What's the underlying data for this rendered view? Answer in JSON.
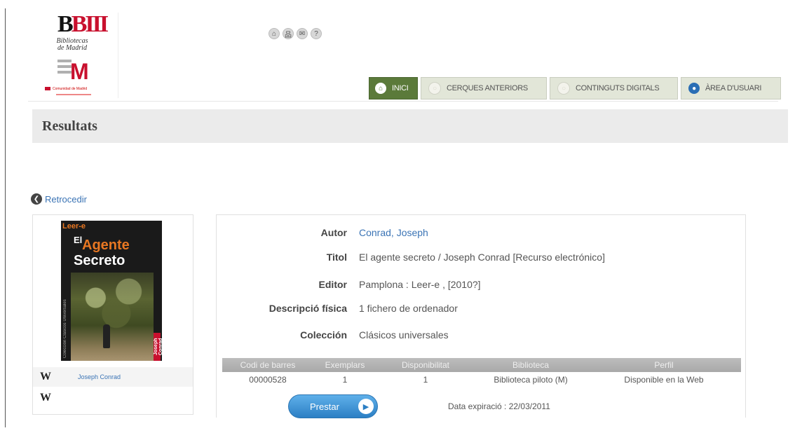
{
  "header": {
    "logo_bm_text": "BIII",
    "logo_subtitle": "Bibliotecas de Madrid",
    "logo_m_text": "M",
    "logo_comunidad": "Comunidad de Madrid",
    "top_icons": [
      {
        "icon": "home-icon",
        "glyph": "⌂"
      },
      {
        "icon": "sitemap-icon",
        "glyph": "品"
      },
      {
        "icon": "mail-icon",
        "glyph": "✉"
      },
      {
        "icon": "help-icon",
        "glyph": "?"
      }
    ]
  },
  "tabs": [
    {
      "label": "INICI",
      "icon": "home-icon",
      "glyph": "⌂"
    },
    {
      "label": "CERQUES ANTERIORS",
      "icon": "history-icon",
      "glyph": "○"
    },
    {
      "label": "CONTINGUTS DIGITALS",
      "icon": "digital-content-icon",
      "glyph": "○"
    },
    {
      "label": "ÀREA D'USUARI",
      "icon": "user-icon",
      "glyph": "●"
    }
  ],
  "page_title": "Resultats",
  "back_link": "Retrocedir",
  "cover": {
    "brand": "Leer-e",
    "title_small": "El",
    "title_line1": "Agente",
    "title_line2": "Secreto",
    "spine": "Colección Clásicos Universales",
    "author_spine": "Joseph Conrad"
  },
  "side_links": [
    {
      "icon": "wikipedia-icon",
      "glyph": "W",
      "label": "Joseph Conrad"
    },
    {
      "icon": "wikipedia-icon",
      "glyph": "W",
      "label": ""
    }
  ],
  "record": {
    "fields": [
      {
        "label": "Autor",
        "value": "Conrad, Joseph",
        "link": true
      },
      {
        "label": "Titol",
        "value": "El agente secreto / Joseph Conrad [Recurso electrónico]",
        "link": false
      },
      {
        "label": "Editor",
        "value": "Pamplona : Leer-e , [2010?]",
        "link": false
      },
      {
        "label": "Descripció física",
        "value": "1 fichero de ordenador",
        "link": false
      },
      {
        "label": "Colección",
        "value": "Clásicos universales",
        "link": false
      }
    ]
  },
  "copies_table": {
    "headers": [
      "Codi de barres",
      "Exemplars",
      "Disponibilitat",
      "Biblioteca",
      "Perfil"
    ],
    "rows": [
      [
        "00000528",
        "1",
        "1",
        "Biblioteca piloto (M)",
        "Disponible en la Web"
      ]
    ]
  },
  "actions": {
    "lend_label": "Prestar",
    "expiry_text": "Data expiració : 22/03/2011"
  }
}
